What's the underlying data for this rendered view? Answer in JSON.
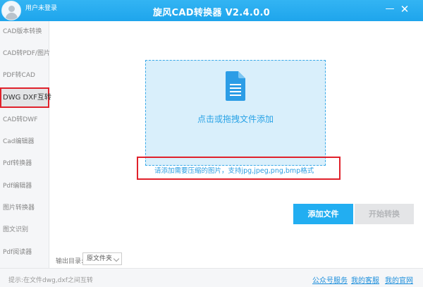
{
  "titlebar": {
    "user_label": "用户未登录",
    "title": "旋风CAD转换器 V2.4.0.0",
    "minimize_glyph": "—",
    "close_glyph": "✕"
  },
  "sidebar": {
    "items": [
      {
        "label": "CAD版本转换",
        "active": false
      },
      {
        "label": "CAD转PDF/图片",
        "active": false
      },
      {
        "label": "PDF转CAD",
        "active": false
      },
      {
        "label": "DWG DXF互转",
        "active": true
      },
      {
        "label": "CAD转DWF",
        "active": false
      },
      {
        "label": "Cad编辑器",
        "active": false
      },
      {
        "label": "Pdf转换器",
        "active": false
      },
      {
        "label": "Pdf编辑器",
        "active": false
      },
      {
        "label": "图片转换器",
        "active": false
      },
      {
        "label": "图文识别",
        "active": false
      },
      {
        "label": "Pdf阅读器",
        "active": false
      }
    ]
  },
  "main": {
    "drop_text": "点击或拖拽文件添加",
    "hint": "请添加需要压缩的图片，支持jpg,jpeg,png,bmp格式",
    "add_button": "添加文件",
    "start_button": "开始转换",
    "output_label": "输出目录:",
    "output_value": "原文件夹"
  },
  "statusbar": {
    "tip": "提示:在文件dwg,dxf之间互转",
    "links": [
      "公众号服务",
      "我的客服",
      "我的官网"
    ]
  },
  "colors": {
    "accent": "#22aef1",
    "titlebar": "#1ea5ec",
    "highlight_border": "#e0212b",
    "dropzone_bg": "#d9effb"
  },
  "icons": {
    "avatar": "user-avatar-icon",
    "file": "document-icon",
    "dropdown": "chevron-down-icon"
  }
}
